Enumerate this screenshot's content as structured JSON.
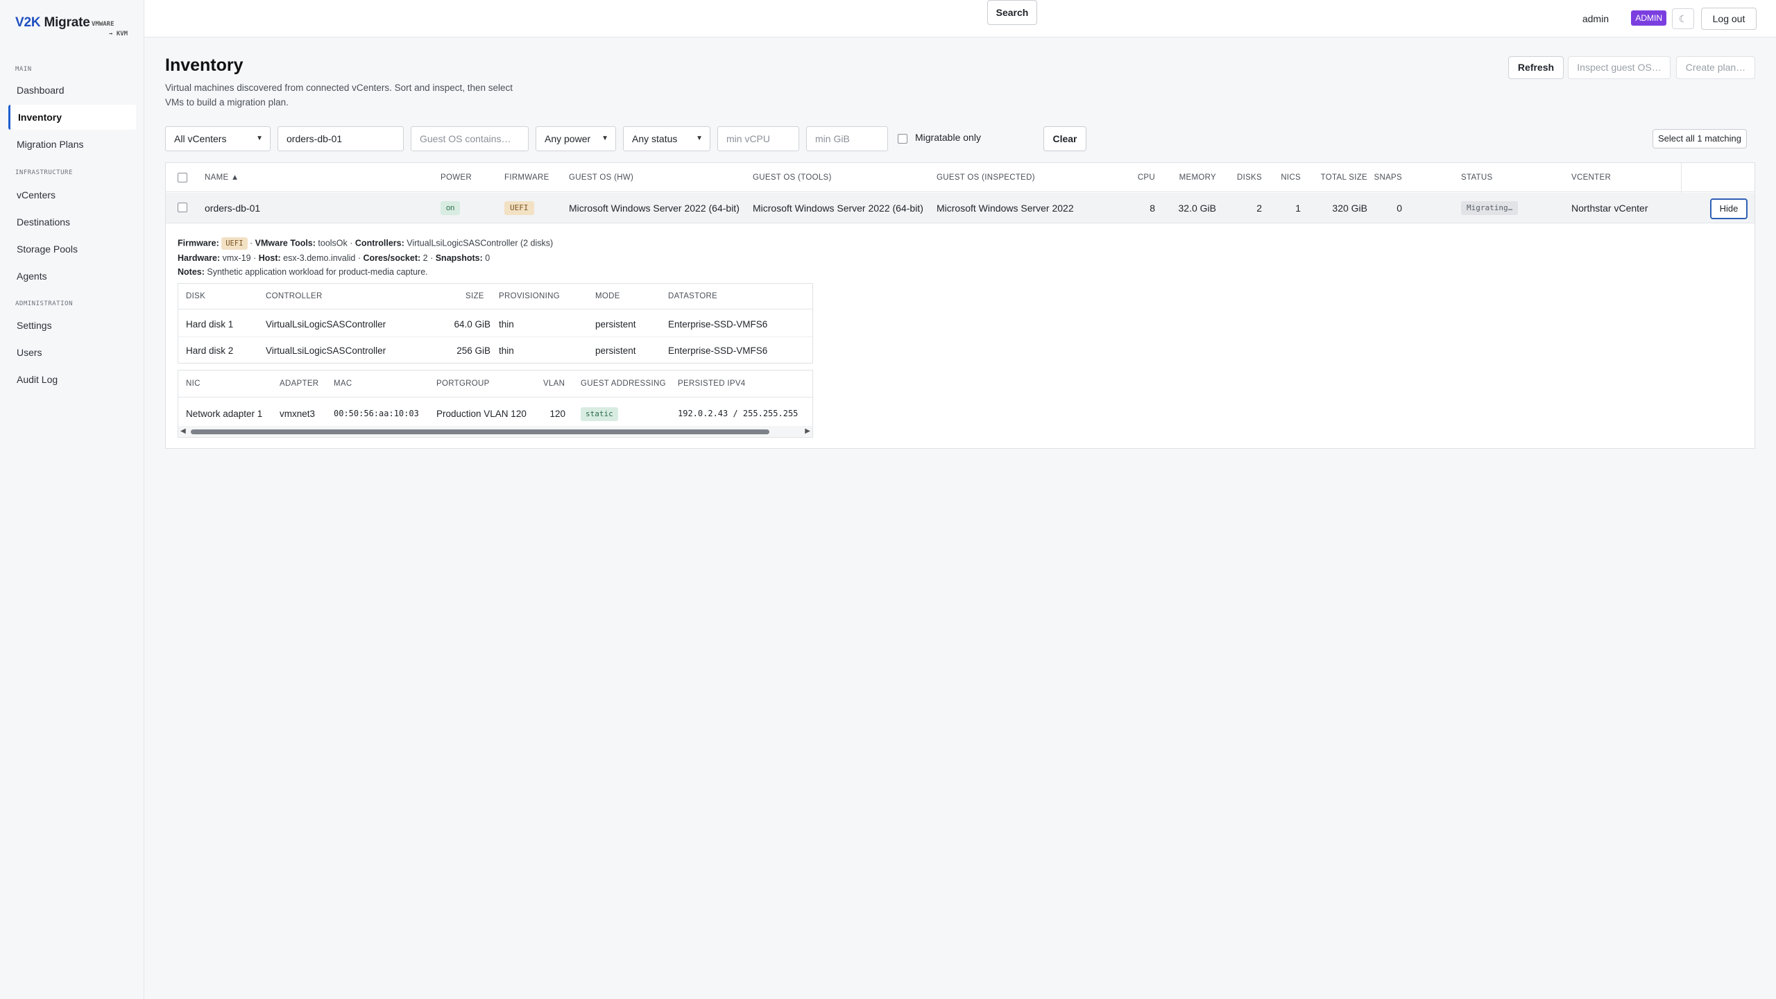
{
  "brand": {
    "name_prefix": "V2K",
    "name_suffix": " Migrate",
    "sub_line1": "VMWARE",
    "sub_line2": "→ KVM"
  },
  "sidebar": {
    "sections": {
      "main": "MAIN",
      "infrastructure": "INFRASTRUCTURE",
      "administration": "ADMINISTRATION"
    },
    "items": [
      {
        "label": "Dashboard"
      },
      {
        "label": "Inventory",
        "active": true
      },
      {
        "label": "Migration Plans"
      },
      {
        "label": "vCenters"
      },
      {
        "label": "Destinations"
      },
      {
        "label": "Storage Pools"
      },
      {
        "label": "Agents"
      },
      {
        "label": "Settings"
      },
      {
        "label": "Users"
      },
      {
        "label": "Audit Log"
      }
    ]
  },
  "topbar": {
    "user": "admin",
    "role": "ADMIN",
    "theme_icon": "☾",
    "logout": "Log out"
  },
  "page": {
    "title": "Inventory",
    "description": "Virtual machines discovered from connected vCenters. Sort and inspect, then select VMs to build a migration plan.",
    "actions": {
      "refresh": "Refresh",
      "inspect": "Inspect guest OS…",
      "create": "Create plan…"
    }
  },
  "filters": {
    "vcenter": "All vCenters",
    "name_value": "orders-db-01",
    "guest_os_placeholder": "Guest OS contains…",
    "power": "Any power",
    "status": "Any status",
    "min_vcpu_placeholder": "min vCPU",
    "min_gib_placeholder": "min GiB",
    "migratable_label": "Migratable only",
    "search": "Search",
    "clear": "Clear",
    "select_all": "Select all 1 matching"
  },
  "table": {
    "headers": {
      "name": "NAME ▲",
      "power": "POWER",
      "firmware": "FIRMWARE",
      "guest_hw": "GUEST OS (HW)",
      "guest_tools": "GUEST OS (TOOLS)",
      "guest_inspected": "GUEST OS (INSPECTED)",
      "cpu": "CPU",
      "memory": "MEMORY",
      "disks": "DISKS",
      "nics": "NICS",
      "total_size": "TOTAL SIZE",
      "snaps": "SNAPS",
      "status": "STATUS",
      "vcenter": "VCENTER"
    },
    "row": {
      "name": "orders-db-01",
      "power": "on",
      "firmware": "UEFI",
      "guest_hw": "Microsoft Windows Server 2022 (64-bit)",
      "guest_tools": "Microsoft Windows Server 2022 (64-bit)",
      "guest_inspected": "Microsoft Windows Server 2022",
      "cpu": "8",
      "memory": "32.0 GiB",
      "disks": "2",
      "nics": "1",
      "total_size": "320 GiB",
      "snaps": "0",
      "status": "Migrating…",
      "vcenter": "Northstar vCenter",
      "hide": "Hide"
    }
  },
  "detail": {
    "firmware_label": "Firmware:",
    "firmware": "UEFI",
    "tools_label": "VMware Tools:",
    "tools": "toolsOk",
    "controllers_label": "Controllers:",
    "controllers": "VirtualLsiLogicSASController (2 disks)",
    "hardware_label": "Hardware:",
    "hardware": "vmx-19",
    "host_label": "Host:",
    "host": "esx-3.demo.invalid",
    "cores_label": "Cores/socket:",
    "cores": "2",
    "snapshots_label": "Snapshots:",
    "snapshots": "0",
    "notes_label": "Notes:",
    "notes": "Synthetic application workload for product-media capture.",
    "sep": " · ",
    "disks": {
      "headers": {
        "disk": "DISK",
        "controller": "CONTROLLER",
        "size": "SIZE",
        "provisioning": "PROVISIONING",
        "mode": "MODE",
        "datastore": "DATASTORE"
      },
      "rows": [
        {
          "disk": "Hard disk 1",
          "controller": "VirtualLsiLogicSASController",
          "size": "64.0 GiB",
          "provisioning": "thin",
          "mode": "persistent",
          "datastore": "Enterprise-SSD-VMFS6"
        },
        {
          "disk": "Hard disk 2",
          "controller": "VirtualLsiLogicSASController",
          "size": "256 GiB",
          "provisioning": "thin",
          "mode": "persistent",
          "datastore": "Enterprise-SSD-VMFS6"
        }
      ]
    },
    "nics": {
      "headers": {
        "nic": "NIC",
        "adapter": "ADAPTER",
        "mac": "MAC",
        "portgroup": "PORTGROUP",
        "vlan": "VLAN",
        "addressing": "GUEST ADDRESSING",
        "ipv4": "PERSISTED IPV4"
      },
      "rows": [
        {
          "nic": "Network adapter 1",
          "adapter": "vmxnet3",
          "mac": "00:50:56:aa:10:03",
          "portgroup": "Production VLAN 120",
          "vlan": "120",
          "addressing": "static",
          "ipv4": "192.0.2.43 / 255.255.255"
        }
      ]
    }
  }
}
